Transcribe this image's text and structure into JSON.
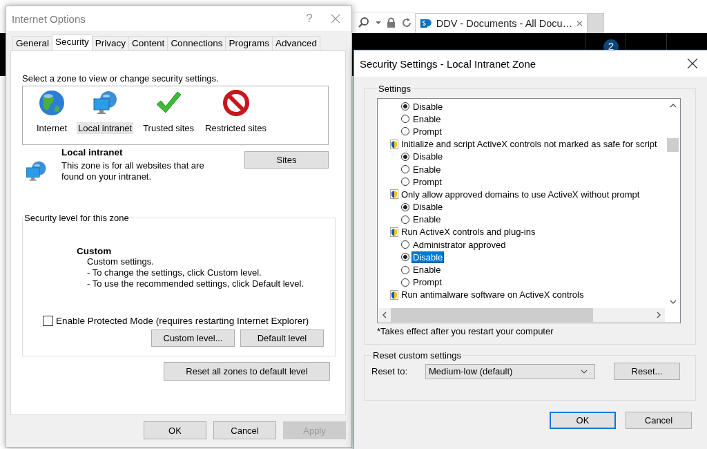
{
  "browser": {
    "tab_title": "DDV - Documents - All Docu…",
    "notification_badge": "2"
  },
  "internet_options": {
    "title": "Internet Options",
    "help": "?",
    "tabs": [
      {
        "label": "General",
        "selected": false
      },
      {
        "label": "Security",
        "selected": true
      },
      {
        "label": "Privacy",
        "selected": false
      },
      {
        "label": "Content",
        "selected": false
      },
      {
        "label": "Connections",
        "selected": false
      },
      {
        "label": "Programs",
        "selected": false
      },
      {
        "label": "Advanced",
        "selected": false
      }
    ],
    "zone_prompt": "Select a zone to view or change security settings.",
    "zones": [
      {
        "kind": "internet",
        "label": "Internet",
        "selected": false
      },
      {
        "kind": "intranet",
        "label": "Local intranet",
        "selected": true
      },
      {
        "kind": "trusted",
        "label": "Trusted sites",
        "selected": false
      },
      {
        "kind": "restricted",
        "label": "Restricted sites",
        "selected": false
      }
    ],
    "zone_info": {
      "name": "Local intranet",
      "description": "This zone is for all websites that are found on your intranet.",
      "sites_button": "Sites"
    },
    "security_level": {
      "legend": "Security level for this zone",
      "level_name": "Custom",
      "description": [
        "Custom settings.",
        "- To change the settings, click Custom level.",
        "- To use the recommended settings, click Default level."
      ],
      "protected_mode": {
        "label": "Enable Protected Mode (requires restarting Internet Explorer)",
        "checked": false
      },
      "buttons": [
        "Custom level...",
        "Default level"
      ]
    },
    "reset_all_button": "Reset all zones to default level",
    "buttons": [
      {
        "label": "OK",
        "disabled": false
      },
      {
        "label": "Cancel",
        "disabled": false
      },
      {
        "label": "Apply",
        "disabled": true
      }
    ]
  },
  "security_settings": {
    "title": "Security Settings - Local Intranet Zone",
    "settings_legend": "Settings",
    "settings": [
      {
        "kind": "option",
        "label": "Disable",
        "checked": true,
        "selected": false
      },
      {
        "kind": "option",
        "label": "Enable",
        "checked": false,
        "selected": false
      },
      {
        "kind": "option",
        "label": "Prompt",
        "checked": false,
        "selected": false
      },
      {
        "kind": "group",
        "label": "Initialize and script ActiveX controls not marked as safe for script",
        "children": [
          {
            "kind": "option",
            "label": "Disable",
            "checked": true,
            "selected": false
          },
          {
            "kind": "option",
            "label": "Enable",
            "checked": false,
            "selected": false
          },
          {
            "kind": "option",
            "label": "Prompt",
            "checked": false,
            "selected": false
          }
        ]
      },
      {
        "kind": "group",
        "label": "Only allow approved domains to use ActiveX without prompt",
        "children": [
          {
            "kind": "option",
            "label": "Disable",
            "checked": true,
            "selected": false
          },
          {
            "kind": "option",
            "label": "Enable",
            "checked": false,
            "selected": false
          }
        ]
      },
      {
        "kind": "group",
        "label": "Run ActiveX controls and plug-ins",
        "children": [
          {
            "kind": "option",
            "label": "Administrator approved",
            "checked": false,
            "selected": false
          },
          {
            "kind": "option",
            "label": "Disable",
            "checked": true,
            "selected": true
          },
          {
            "kind": "option",
            "label": "Enable",
            "checked": false,
            "selected": false
          },
          {
            "kind": "option",
            "label": "Prompt",
            "checked": false,
            "selected": false
          }
        ]
      },
      {
        "kind": "group",
        "label": "Run antimalware software on ActiveX controls"
      }
    ],
    "note": "*Takes effect after you restart your computer",
    "reset": {
      "legend": "Reset custom settings",
      "label": "Reset to:",
      "value": "Medium-low (default)",
      "button": "Reset..."
    },
    "buttons": [
      {
        "label": "OK",
        "default": true
      },
      {
        "label": "Cancel",
        "default": false
      }
    ]
  }
}
